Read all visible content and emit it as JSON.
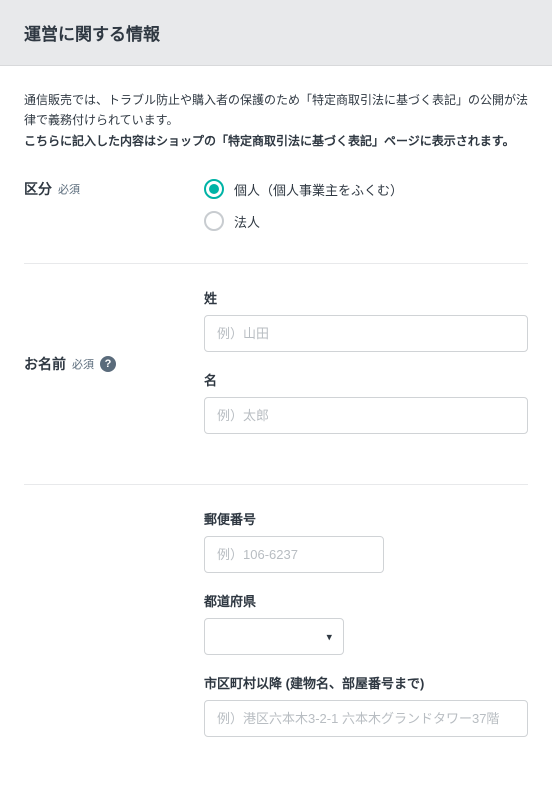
{
  "header": {
    "title": "運営に関する情報"
  },
  "intro": {
    "line1": "通信販売では、トラブル防止や購入者の保護のため「特定商取引法に基づく表記」の公開が法律で義務付けられています。",
    "line2": "こちらに記入した内容はショップの「特定商取引法に基づく表記」ページに表示されます。"
  },
  "labels": {
    "required": "必須",
    "help": "?"
  },
  "kubun": {
    "label": "区分",
    "options": {
      "kojin": "個人（個人事業主をふくむ）",
      "hojin": "法人"
    }
  },
  "name": {
    "label": "お名前",
    "sei": {
      "label": "姓",
      "placeholder": "例）山田"
    },
    "mei": {
      "label": "名",
      "placeholder": "例）太郎"
    }
  },
  "postal": {
    "label": "郵便番号",
    "placeholder": "例）106-6237"
  },
  "prefecture": {
    "label": "都道府県"
  },
  "address": {
    "label": "市区町村以降 (建物名、部屋番号まで)",
    "placeholder": "例）港区六本木3-2-1 六本木グランドタワー37階"
  }
}
